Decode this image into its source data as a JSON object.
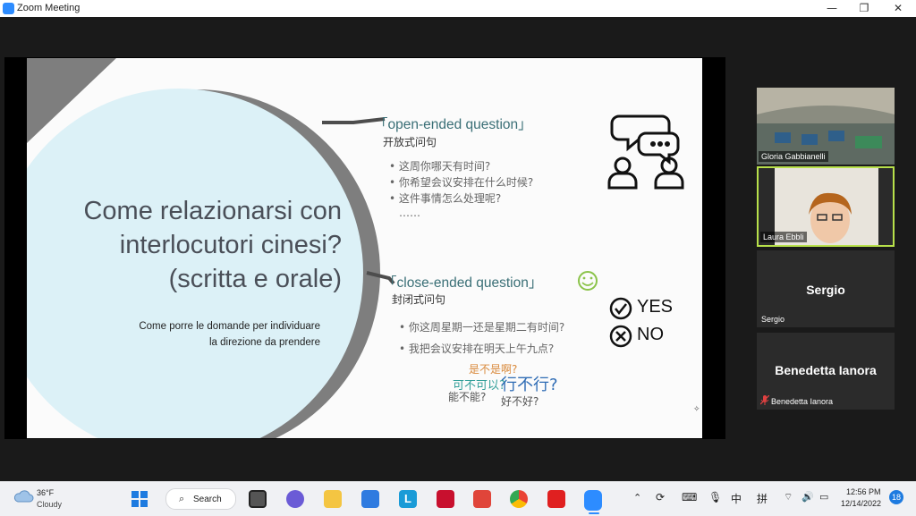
{
  "window": {
    "title": "Zoom Meeting",
    "minimize_icon": "minimize-icon",
    "maximize_icon": "restore-icon",
    "close_icon": "close-icon"
  },
  "slide": {
    "title_lines": [
      "Come relazionarsi con",
      "interlocutori cinesi?",
      "(scritta e orale)"
    ],
    "subtitle_lines": [
      "Come porre le domande per individuare",
      "la direzione da prendere"
    ],
    "open": {
      "heading": "「open-ended question」",
      "sub": "开放式问句",
      "bullets": [
        "•  这周你哪天有时间?",
        "•  你希望会议安排在什么时候?",
        "•  这件事情怎么处理呢?"
      ],
      "ellipsis": "……"
    },
    "close": {
      "heading": "「close-ended question」",
      "sub": "封闭式问句",
      "bullets": [
        "•  你这周星期一还是星期二有时间?",
        "•  我把会议安排在明天上午九点?"
      ],
      "phrases": [
        "是不是啊?",
        "可不可以?",
        "行不行?",
        "能不能?",
        "好不好?"
      ]
    },
    "yes": "YES",
    "no": "NO",
    "accent_color": "#3a6f76",
    "circle_color": "#dcf1f7",
    "gray_color": "#7e7e7e"
  },
  "participants": [
    {
      "name": "Gloria Gabbianelli",
      "big": ""
    },
    {
      "name": "Laura Ebbli",
      "big": ""
    },
    {
      "name": "Sergio",
      "big": "Sergio"
    },
    {
      "name": "Benedetta Ianora",
      "big": "Benedetta Ianora",
      "muted_icon": "mic-muted-icon"
    }
  ],
  "taskbar": {
    "weather_temp": "36°F",
    "weather_desc": "Cloudy",
    "search_label": "Search",
    "ime_1": "中",
    "ime_2": "拼",
    "time": "12:56 PM",
    "date": "12/14/2022",
    "notif_count": "18"
  }
}
